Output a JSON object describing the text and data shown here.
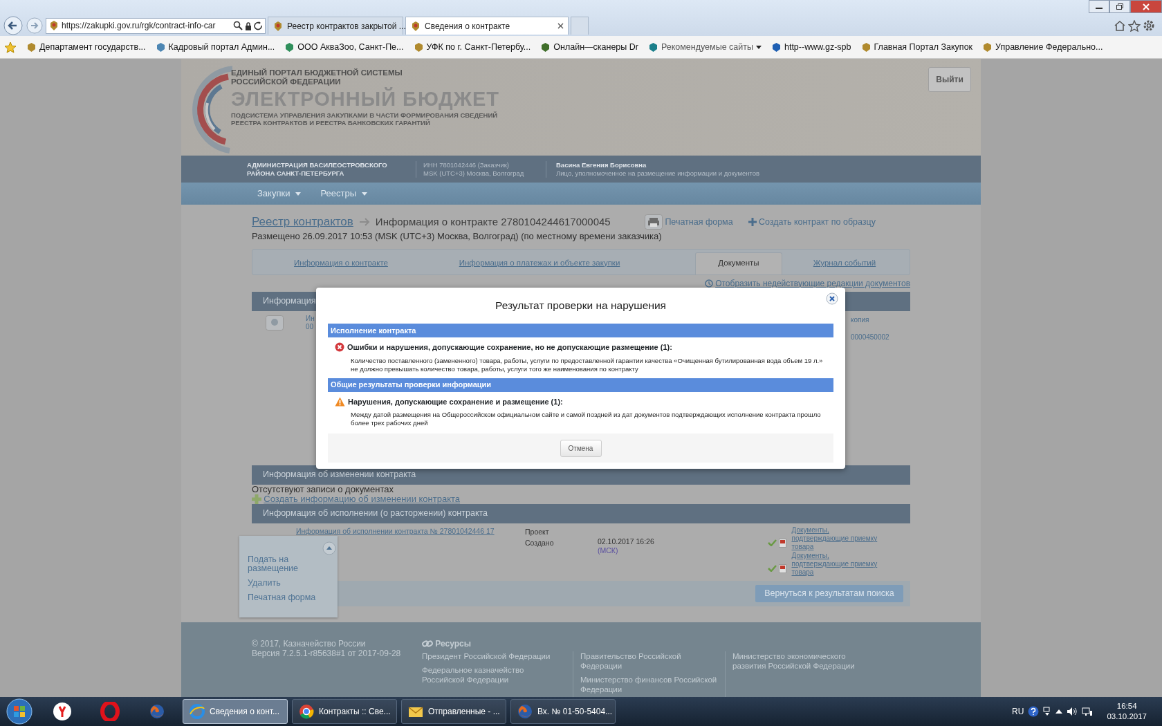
{
  "browser": {
    "address": "https://zakupki.gov.ru/rgk/contract-info-car",
    "tabs": [
      {
        "label": "Реестр контрактов закрытой ...",
        "selected": false
      },
      {
        "label": "Сведения о контракте",
        "selected": true
      }
    ]
  },
  "bookmarks": [
    {
      "label": "Департамент государств...",
      "kind": "site"
    },
    {
      "label": "Кадровый портал Админ...",
      "kind": "site"
    },
    {
      "label": "ООО АкваЗоо, Санкт-Пе...",
      "kind": "site"
    },
    {
      "label": "УФК по г. Санкт-Петербу...",
      "kind": "site"
    },
    {
      "label": "Онлайн—сканеры Dr",
      "kind": "site"
    },
    {
      "label": "Рекомендуемые сайты",
      "kind": "folder"
    },
    {
      "label": "http--www.gz-spb",
      "kind": "site"
    },
    {
      "label": "Главная Портал Закупок",
      "kind": "site"
    },
    {
      "label": "Управление Федерально...",
      "kind": "site"
    }
  ],
  "header": {
    "portal_lines": [
      "ЕДИНЫЙ ПОРТАЛ БЮДЖЕТНОЙ СИСТЕМЫ",
      "РОССИЙСКОЙ ФЕДЕРАЦИИ"
    ],
    "title": "ЭЛЕКТРОННЫЙ БЮДЖЕТ",
    "subtitle_lines": [
      "ПОДСИСТЕМА УПРАВЛЕНИЯ ЗАКУПКАМИ В ЧАСТИ ФОРМИРОВАНИЯ СВЕДЕНИЙ",
      "РЕЕСТРА КОНТРАКТОВ И РЕЕСТРА БАНКОВСКИХ ГАРАНТИЙ"
    ],
    "logout": "Выйти"
  },
  "org_bar": {
    "organization_lines": [
      "АДМИНИСТРАЦИЯ ВАСИЛЕОСТРОВСКОГО",
      "РАЙОНА САНКТ-ПЕТЕРБУРГА"
    ],
    "inn": "ИНН 7801042446 (Заказчик)",
    "timezone": "MSK (UTC+3) Москва, Волгоград",
    "user": "Васина Евгения Борисовна",
    "role": "Лицо, уполномоченное на размещение информации и документов"
  },
  "nav": [
    {
      "label": "Закупки"
    },
    {
      "label": "Реестры"
    }
  ],
  "breadcrumb": {
    "link": "Реестр контрактов",
    "current": "Информация о контракте 2780104244617000045"
  },
  "actions": [
    {
      "label": "Печатная форма",
      "kind": "print"
    },
    {
      "label": "Создать контракт по образцу",
      "kind": "add"
    }
  ],
  "placed": "Размещено 26.09.2017 10:53 (MSK (UTC+3) Москва, Волгоград) (по местному времени заказчика)",
  "tabs": [
    {
      "label": "Информация о контракте",
      "selected": false
    },
    {
      "label": "Информация о платежах и объекте закупки",
      "selected": false
    },
    {
      "label": "Документы",
      "selected": true
    },
    {
      "label": "Журнал событий",
      "selected": false
    }
  ],
  "show_inactive": "Отобразить недействующие редакции документов",
  "documents_section": {
    "title": "Информация",
    "left_fragments": [
      "Ин",
      "00"
    ],
    "right_fragments": [
      "копия",
      "0000450002"
    ]
  },
  "changes_section": {
    "title": "Информация об изменении контракта",
    "empty_text": "Отсутствуют записи о документах",
    "create_link": "Создать информацию об изменении контракта"
  },
  "execution_section": {
    "title": "Информация об исполнении (о расторжении) контракта",
    "rows": [
      {
        "document": "Информация об исполнении контракта № 27801042446 17",
        "status": "Проект",
        "created_label": "Создано",
        "created_at": "02.10.2017 16:26",
        "timezone": "(МСК)",
        "attachments": [
          {
            "label": "Документы, подтверждающие приемку товара"
          },
          {
            "label": "Документы, подтверждающие приемку товара"
          }
        ]
      }
    ],
    "back_button": "Вернуться к результатам поиска"
  },
  "row_menu": {
    "items": [
      {
        "label": "Подать на размещение"
      },
      {
        "label": "Удалить"
      },
      {
        "label": "Печатная форма"
      }
    ]
  },
  "dialog": {
    "title": "Результат проверки на нарушения",
    "groups": [
      {
        "title": "Исполнение контракта",
        "kind": "error",
        "heading": "Ошибки и нарушения, допускающие сохранение, но не допускающие размещение (1):",
        "message": "Количество поставленного (замененного) товара, работы, услуги по предоставленной гарантии качества «Очищенная бутилированная вода объем 19 л.» не должно превышать количество товара, работы, услуги того же наименования по контракту"
      },
      {
        "title": "Общие результаты проверки информации",
        "kind": "warning",
        "heading": "Нарушения, допускающие сохранение и размещение (1):",
        "message": "Между датой размещения на Общероссийском официальном сайте и самой поздней из дат документов подтверждающих исполнение контракта прошло более трех рабочих дней"
      }
    ],
    "cancel": "Отмена"
  },
  "footer": {
    "copyright": "© 2017, Казначейство России",
    "version": "Версия 7.2.5.1-r85638#1 от 2017-09-28",
    "resources_title": "Ресурсы",
    "columns": [
      {
        "links": [
          "Президент Российской Федерации",
          "Федеральное казначейство Российской Федерации"
        ]
      },
      {
        "links": [
          "Правительство Российской Федерации",
          "Министерство финансов Российской Федерации"
        ]
      },
      {
        "links": [
          "Министерство экономического развития Российской Федерации"
        ]
      }
    ]
  },
  "taskbar": {
    "tasks": [
      {
        "label": "Сведения о конт...",
        "kind": "ie",
        "selected": true
      },
      {
        "label": "Контракты :: Све...",
        "kind": "chrome",
        "selected": false
      },
      {
        "label": "Отправленные - ...",
        "kind": "mail",
        "selected": false
      },
      {
        "label": "Вх. № 01-50-5404...",
        "kind": "firefox",
        "selected": false
      }
    ],
    "language": "RU",
    "time": "16:54",
    "date": "03.10.2017"
  }
}
